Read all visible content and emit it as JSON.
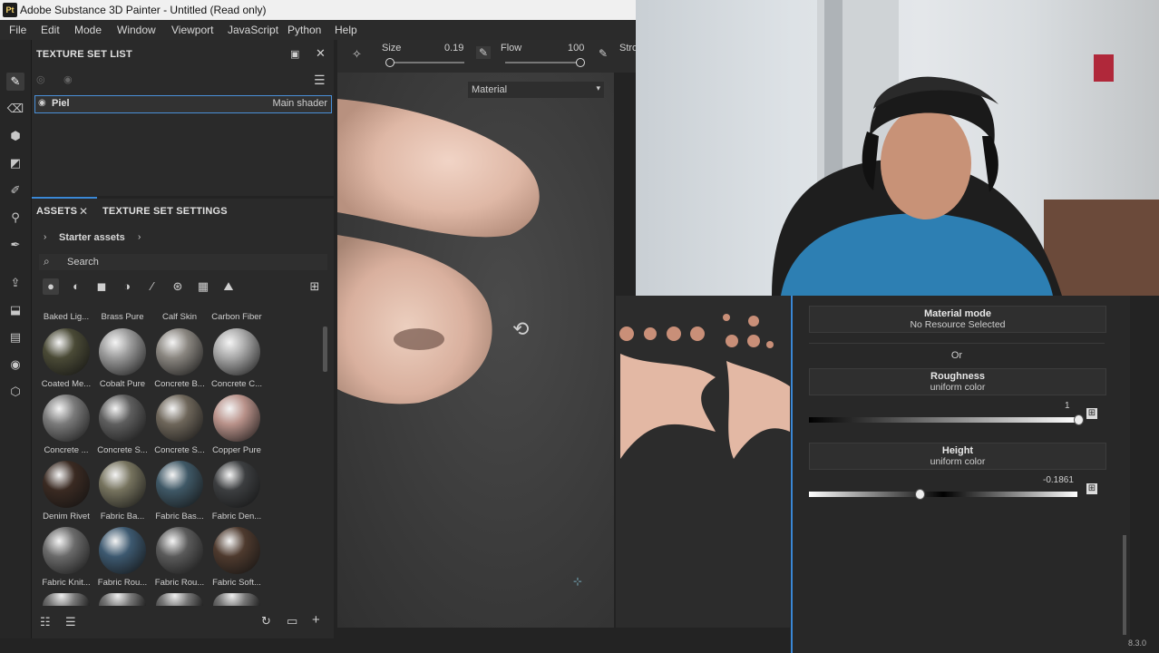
{
  "window": {
    "logo": "Pt",
    "title": "Adobe Substance 3D Painter - Untitled (Read only)"
  },
  "menu": [
    "File",
    "Edit",
    "Mode",
    "Window",
    "Viewport",
    "JavaScript",
    "Python",
    "Help"
  ],
  "toolbar": {
    "size_label": "Size",
    "size_value": "0.19",
    "flow_label": "Flow",
    "flow_value": "100",
    "stroke_label": "Stro",
    "size_fraction": 0.03,
    "flow_fraction": 1.0
  },
  "texture_set_list": {
    "title": "TEXTURE SET LIST",
    "rows": [
      {
        "name": "Piel",
        "shader": "Main shader"
      }
    ]
  },
  "assets": {
    "tab_assets": "ASSETS",
    "tab_texture_set_settings": "TEXTURE SET SETTINGS",
    "breadcrumb": "Starter assets",
    "search_placeholder": "Search",
    "top_labels": [
      "Baked Lig...",
      "Brass Pure",
      "Calf Skin",
      "Carbon Fiber"
    ],
    "items": [
      {
        "label": "Coated Me...",
        "color": "#4a4a36"
      },
      {
        "label": "Cobalt Pure",
        "color": "#9a9a9a"
      },
      {
        "label": "Concrete B...",
        "color": "#8a8680"
      },
      {
        "label": "Concrete C...",
        "color": "#a8a8a8"
      },
      {
        "label": "Concrete ...",
        "color": "#7a7a7a"
      },
      {
        "label": "Concrete S...",
        "color": "#5e5e5e"
      },
      {
        "label": "Concrete S...",
        "color": "#6e665a"
      },
      {
        "label": "Copper Pure",
        "color": "#b9928a"
      },
      {
        "label": "Denim Rivet",
        "color": "#3a2a22"
      },
      {
        "label": "Fabric Ba...",
        "color": "#76735e"
      },
      {
        "label": "Fabric Bas...",
        "color": "#3f5866"
      },
      {
        "label": "Fabric Den...",
        "color": "#3c3e40"
      },
      {
        "label": "Fabric Knit...",
        "color": "#6a6a6a"
      },
      {
        "label": "Fabric Rou...",
        "color": "#3d5970"
      },
      {
        "label": "Fabric Rou...",
        "color": "#5a5a5a"
      },
      {
        "label": "Fabric Soft...",
        "color": "#4e3a2e"
      }
    ]
  },
  "viewport": {
    "mode_select": "Material"
  },
  "properties": {
    "material_mode_title": "Material mode",
    "material_mode_value": "No Resource Selected",
    "or_label": "Or",
    "roughness_title": "Roughness",
    "roughness_sub": "uniform color",
    "roughness_value": "1",
    "roughness_fraction": 1.0,
    "height_title": "Height",
    "height_sub": "uniform color",
    "height_value": "-0.1861",
    "height_fraction": 0.41
  },
  "version_label": "8.3.0",
  "colors": {
    "accent": "#3a88d6",
    "skin": "#e3bfae"
  }
}
